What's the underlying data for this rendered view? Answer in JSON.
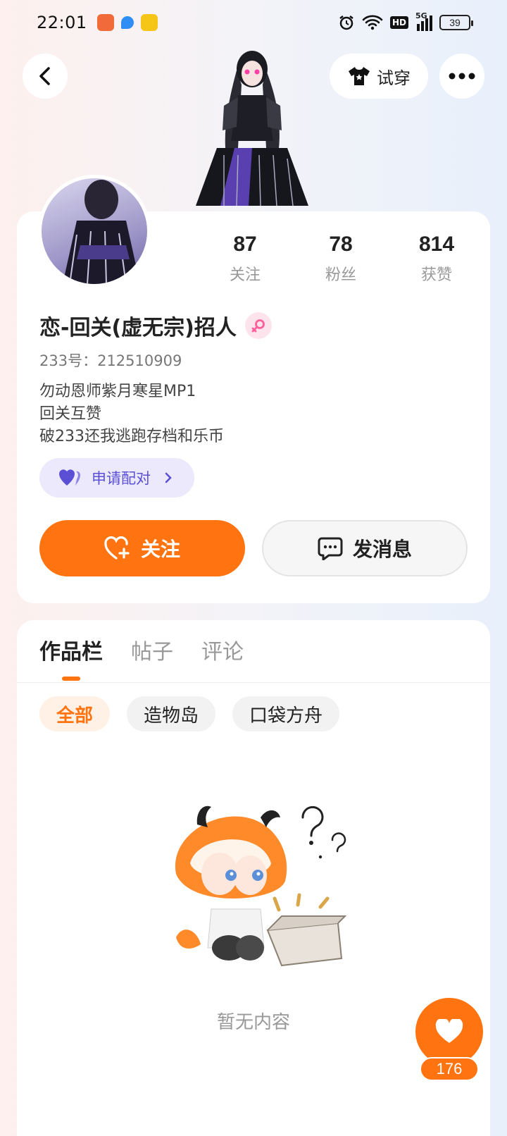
{
  "status_bar": {
    "time": "22:01",
    "network": "5G",
    "hd": "HD",
    "battery": "39"
  },
  "header": {
    "try_on_label": "试穿"
  },
  "profile": {
    "stats": [
      {
        "value": "87",
        "label": "关注"
      },
      {
        "value": "78",
        "label": "粉丝"
      },
      {
        "value": "814",
        "label": "获赞"
      }
    ],
    "nickname": "恋-回关(虚无宗)招人",
    "uid": "233号：212510909",
    "bio": [
      "勿动恩师紫月寒星MP1",
      "回关互赞",
      "破233还我逃跑存档和乐币"
    ],
    "pair_label": "申请配对",
    "follow_label": "关注",
    "message_label": "发消息"
  },
  "tabs": [
    "作品栏",
    "帖子",
    "评论"
  ],
  "filters": [
    "全部",
    "造物岛",
    "口袋方舟"
  ],
  "empty_text": "暂无内容",
  "like_count": "176",
  "colors": {
    "accent": "#ff7410",
    "pair_purple": "#5b4fd6"
  }
}
